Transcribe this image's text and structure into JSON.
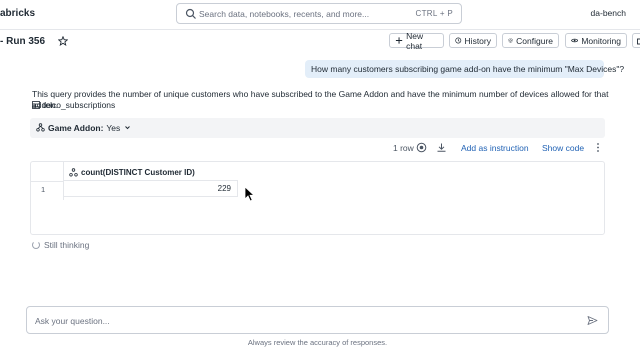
{
  "topbar": {
    "brand": "abricks",
    "search_placeholder": "Search data, notebooks, recents, and more...",
    "search_shortcut": "CTRL + P",
    "user": "da-bench"
  },
  "header": {
    "title": "- Run 356",
    "buttons": {
      "new_chat": "New chat",
      "history": "History",
      "configure": "Configure",
      "monitoring": "Monitoring"
    }
  },
  "conversation": {
    "user_message": "How many customers subscribing game add-on have the minimum \"Max Devices\"?",
    "response_text": "This query provides the number of unique customers who have subscribed to the Game Addon and have the minimum number of devices allowed for that addon.",
    "table_ref": "telco_subscriptions",
    "filter": {
      "label": "Game Addon:",
      "value": "Yes"
    }
  },
  "result": {
    "row_count": "1 row",
    "add_as_instruction": "Add as instruction",
    "show_code": "Show code",
    "columns": [
      "count(DISTINCT Customer ID)"
    ],
    "rows": [
      {
        "rownum": "1",
        "value": "229"
      }
    ]
  },
  "status": {
    "thinking": "Still thinking"
  },
  "input": {
    "placeholder": "Ask your question...",
    "disclaimer": "Always review the accuracy of responses."
  },
  "colors": {
    "accent_link": "#2263b5",
    "user_bubble": "#e3eef9",
    "filter_bar": "#f3f4f6"
  }
}
